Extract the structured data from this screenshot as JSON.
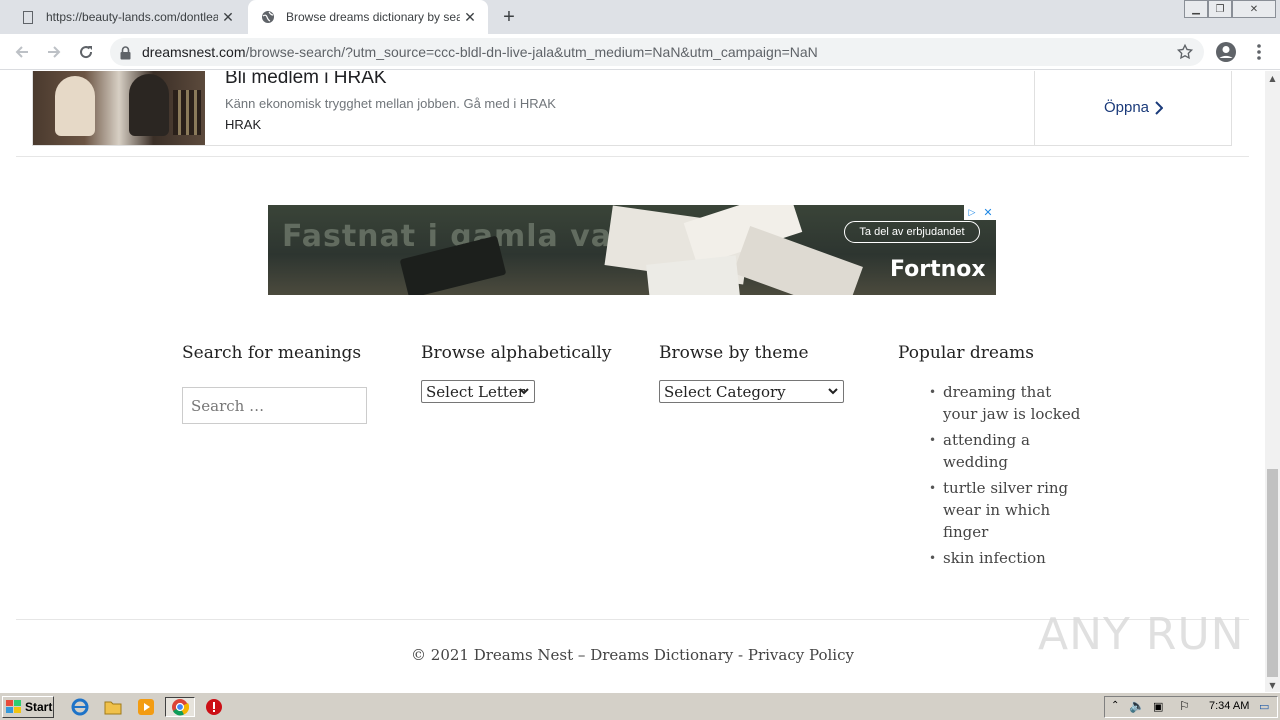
{
  "browser": {
    "tabs": [
      {
        "title": "https://beauty-lands.com/dontleave",
        "active": false
      },
      {
        "title": "Browse dreams dictionary by search",
        "active": true
      }
    ],
    "url_host": "dreamsnest.com",
    "url_path": "/browse-search/?utm_source=ccc-bldl-dn-live-jala&utm_medium=NaN&utm_campaign=NaN"
  },
  "ad_top": {
    "headline": "Bli medlem i HRAK",
    "description": "Känn ekonomisk trygghet mellan jobben. Gå med i HRAK",
    "brand": "HRAK",
    "cta": "Öppna"
  },
  "ad_banner": {
    "headline": "Fastnat i gamla vanor",
    "cta": "Ta del av erbjudandet",
    "logo": "Fortnox"
  },
  "widgets": {
    "search": {
      "title": "Search for meanings",
      "placeholder": "Search …"
    },
    "alpha": {
      "title": "Browse alphabetically",
      "selected": "Select Letter"
    },
    "theme": {
      "title": "Browse by theme",
      "selected": "Select Category"
    },
    "popular": {
      "title": "Popular dreams",
      "items": [
        "dreaming that your jaw is locked",
        "attending a wedding",
        "turtle silver ring wear in which finger",
        "skin infection"
      ]
    }
  },
  "footer": {
    "copyright": "© 2021 Dreams Nest – Dreams Dictionary",
    "separator": "-",
    "privacy": "Privacy Policy"
  },
  "watermark": "ANY RUN",
  "taskbar": {
    "start": "Start",
    "clock": "7:34 AM"
  }
}
